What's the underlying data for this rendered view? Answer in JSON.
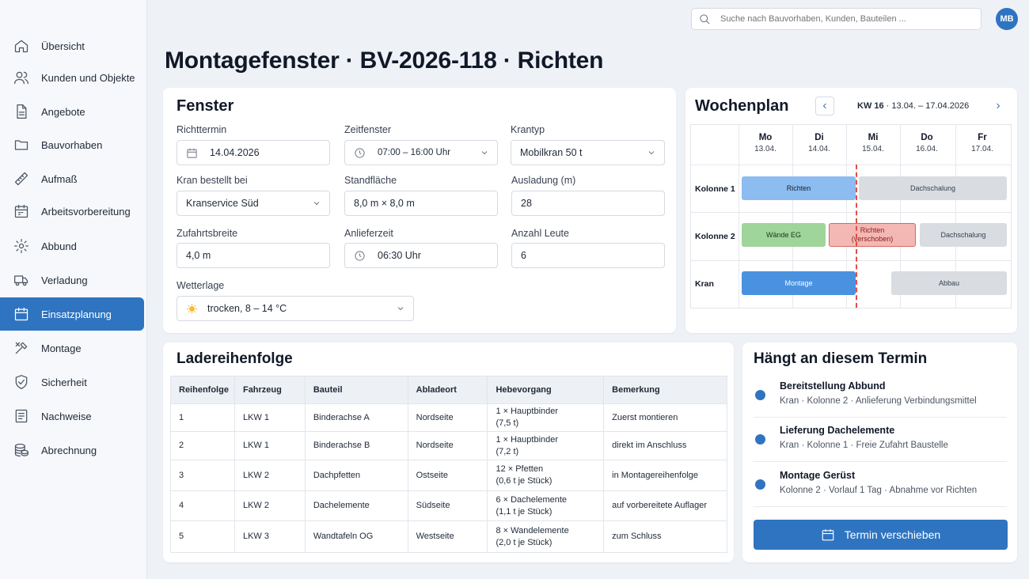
{
  "sidebar": {
    "items": [
      {
        "label": "Übersicht",
        "icon": "home-icon"
      },
      {
        "label": "Kunden und Objekte",
        "icon": "users-icon"
      },
      {
        "label": "Angebote",
        "icon": "document-icon"
      },
      {
        "label": "Bauvorhaben",
        "icon": "folder-icon"
      },
      {
        "label": "Aufmaß",
        "icon": "ruler-icon"
      },
      {
        "label": "Arbeitsvorbereitung",
        "icon": "calendar-grid-icon"
      },
      {
        "label": "Abbund",
        "icon": "gear-icon"
      },
      {
        "label": "Verladung",
        "icon": "truck-icon"
      },
      {
        "label": "Einsatzplanung",
        "icon": "calendar-icon",
        "active": true
      },
      {
        "label": "Montage",
        "icon": "tools-icon"
      },
      {
        "label": "Sicherheit",
        "icon": "shield-icon"
      },
      {
        "label": "Nachweise",
        "icon": "list-document-icon"
      },
      {
        "label": "Abrechnung",
        "icon": "coins-icon"
      }
    ]
  },
  "topbar": {
    "search_placeholder": "Suche nach Bauvorhaben, Kunden, Bauteilen ...",
    "avatar_initials": "MB"
  },
  "page": {
    "title": "Montagefenster · BV-2026-118 · Richten"
  },
  "fenster": {
    "title": "Fenster",
    "richttermin": {
      "label": "Richttermin",
      "value": "14.04.2026"
    },
    "zeitfenster": {
      "label": "Zeitfenster",
      "value": "07:00 – 16:00 Uhr"
    },
    "krantyp": {
      "label": "Krantyp",
      "value": "Mobilkran 50 t"
    },
    "kran_bestellt": {
      "label": "Kran bestellt bei",
      "value": "Kranservice Süd"
    },
    "standflaeche": {
      "label": "Standfläche",
      "value": "8,0 m × 8,0 m"
    },
    "ausladung": {
      "label": "Ausladung (m)",
      "value": "28"
    },
    "zufahrtsbreite": {
      "label": "Zufahrtsbreite",
      "value": "4,0 m"
    },
    "anlieferzeit": {
      "label": "Anlieferzeit",
      "value": "06:30 Uhr"
    },
    "anzahl_leute": {
      "label": "Anzahl Leute",
      "value": "6"
    },
    "wetterlage": {
      "label": "Wetterlage",
      "value": "trocken, 8 – 14 °C"
    }
  },
  "wochenplan": {
    "title": "Wochenplan",
    "kw_label": "KW 16",
    "kw_range": " · 13.04. – 17.04.2026",
    "days": [
      {
        "d": "Mo",
        "date": "13.04."
      },
      {
        "d": "Di",
        "date": "14.04."
      },
      {
        "d": "Mi",
        "date": "15.04."
      },
      {
        "d": "Do",
        "date": "16.04."
      },
      {
        "d": "Fr",
        "date": "17.04."
      }
    ],
    "rows": [
      "Kolonne 1",
      "Kolonne 2",
      "Kran"
    ],
    "bars": {
      "k1_richten": "Richten",
      "k1_dachschalung": "Dachschalung",
      "k2_waende": "Wände EG",
      "k2_richten_line1": "Richten",
      "k2_richten_line2": "(verschoben)",
      "k2_dachschalung": "Dachschalung",
      "kran_montage": "Montage",
      "kran_abbau": "Abbau"
    }
  },
  "ladereihenfolge": {
    "title": "Ladereihenfolge",
    "columns": [
      "Reihenfolge",
      "Fahrzeug",
      "Bauteil",
      "Abladeort",
      "Hebevorgang",
      "Bemerkung"
    ],
    "rows": [
      {
        "nr": "1",
        "fahrzeug": "LKW 1",
        "bauteil": "Binderachse A",
        "abladeort": "Nordseite",
        "heb1": "1 × Hauptbinder",
        "heb2": "(7,5 t)",
        "bemerkung": "Zuerst montieren"
      },
      {
        "nr": "2",
        "fahrzeug": "LKW 1",
        "bauteil": "Binderachse B",
        "abladeort": "Nordseite",
        "heb1": "1 × Hauptbinder",
        "heb2": "(7,2 t)",
        "bemerkung": "direkt im Anschluss"
      },
      {
        "nr": "3",
        "fahrzeug": "LKW 2",
        "bauteil": "Dachpfetten",
        "abladeort": "Ostseite",
        "heb1": "12 × Pfetten",
        "heb2": "(0,6 t je Stück)",
        "bemerkung": "in Montagereihenfolge"
      },
      {
        "nr": "4",
        "fahrzeug": "LKW 2",
        "bauteil": "Dachelemente",
        "abladeort": "Südseite",
        "heb1": "6 × Dachelemente",
        "heb2": "(1,1 t je Stück)",
        "bemerkung": "auf vorbereitete Auflager"
      },
      {
        "nr": "5",
        "fahrzeug": "LKW 3",
        "bauteil": "Wandtafeln OG",
        "abladeort": "Westseite",
        "heb1": "8 × Wandelemente",
        "heb2": "(2,0 t je Stück)",
        "bemerkung": "zum Schluss"
      }
    ]
  },
  "haengt_an": {
    "title": "Hängt an diesem Termin",
    "items": [
      {
        "title": "Bereitstellung Abbund",
        "sub": "Kran · Kolonne 2 · Anlieferung Verbindungsmittel"
      },
      {
        "title": "Lieferung Dachelemente",
        "sub": "Kran · Kolonne 1 · Freie Zufahrt Baustelle"
      },
      {
        "title": "Montage Gerüst",
        "sub": "Kolonne 2 · Vorlauf 1 Tag · Abnahme vor Richten"
      }
    ],
    "button_label": "Termin verschieben"
  },
  "colors": {
    "accent": "#2f74c0",
    "today_line": "#e24d45"
  }
}
